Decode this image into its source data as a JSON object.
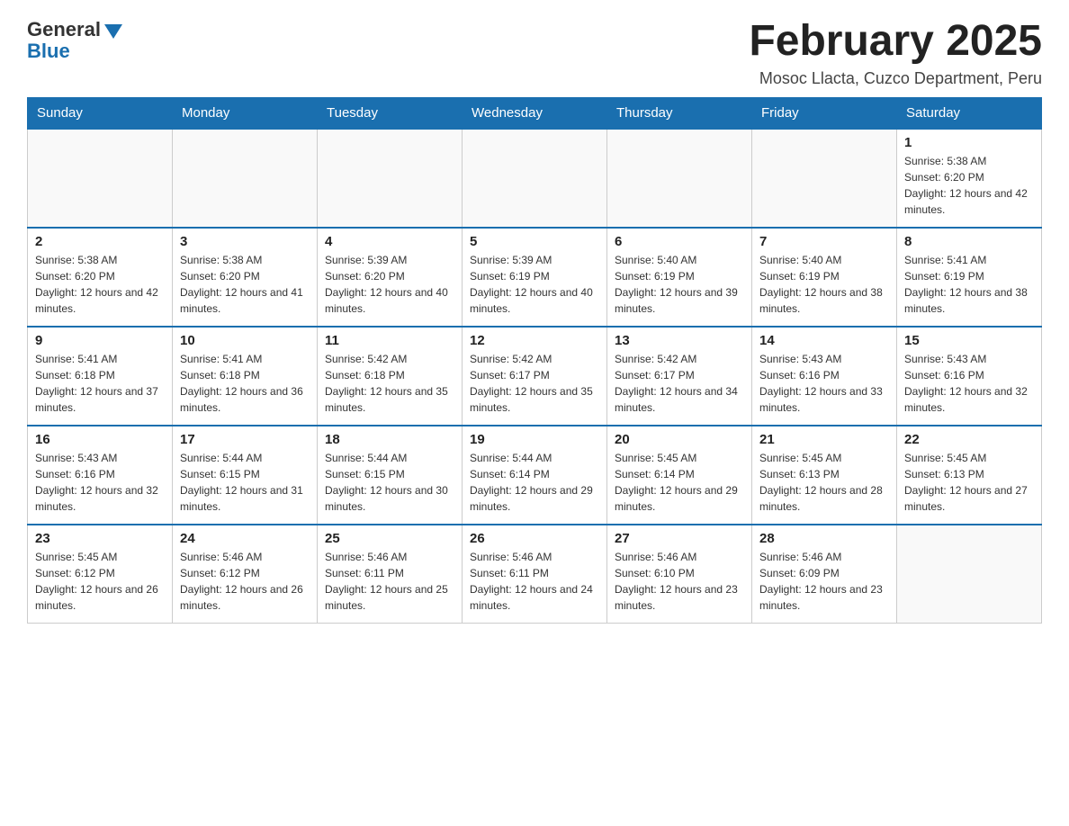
{
  "logo": {
    "general": "General",
    "blue": "Blue"
  },
  "header": {
    "title": "February 2025",
    "subtitle": "Mosoc Llacta, Cuzco Department, Peru"
  },
  "days_of_week": [
    "Sunday",
    "Monday",
    "Tuesday",
    "Wednesday",
    "Thursday",
    "Friday",
    "Saturday"
  ],
  "weeks": [
    {
      "days": [
        {
          "number": "",
          "info": ""
        },
        {
          "number": "",
          "info": ""
        },
        {
          "number": "",
          "info": ""
        },
        {
          "number": "",
          "info": ""
        },
        {
          "number": "",
          "info": ""
        },
        {
          "number": "",
          "info": ""
        },
        {
          "number": "1",
          "info": "Sunrise: 5:38 AM\nSunset: 6:20 PM\nDaylight: 12 hours and 42 minutes."
        }
      ]
    },
    {
      "days": [
        {
          "number": "2",
          "info": "Sunrise: 5:38 AM\nSunset: 6:20 PM\nDaylight: 12 hours and 42 minutes."
        },
        {
          "number": "3",
          "info": "Sunrise: 5:38 AM\nSunset: 6:20 PM\nDaylight: 12 hours and 41 minutes."
        },
        {
          "number": "4",
          "info": "Sunrise: 5:39 AM\nSunset: 6:20 PM\nDaylight: 12 hours and 40 minutes."
        },
        {
          "number": "5",
          "info": "Sunrise: 5:39 AM\nSunset: 6:19 PM\nDaylight: 12 hours and 40 minutes."
        },
        {
          "number": "6",
          "info": "Sunrise: 5:40 AM\nSunset: 6:19 PM\nDaylight: 12 hours and 39 minutes."
        },
        {
          "number": "7",
          "info": "Sunrise: 5:40 AM\nSunset: 6:19 PM\nDaylight: 12 hours and 38 minutes."
        },
        {
          "number": "8",
          "info": "Sunrise: 5:41 AM\nSunset: 6:19 PM\nDaylight: 12 hours and 38 minutes."
        }
      ]
    },
    {
      "days": [
        {
          "number": "9",
          "info": "Sunrise: 5:41 AM\nSunset: 6:18 PM\nDaylight: 12 hours and 37 minutes."
        },
        {
          "number": "10",
          "info": "Sunrise: 5:41 AM\nSunset: 6:18 PM\nDaylight: 12 hours and 36 minutes."
        },
        {
          "number": "11",
          "info": "Sunrise: 5:42 AM\nSunset: 6:18 PM\nDaylight: 12 hours and 35 minutes."
        },
        {
          "number": "12",
          "info": "Sunrise: 5:42 AM\nSunset: 6:17 PM\nDaylight: 12 hours and 35 minutes."
        },
        {
          "number": "13",
          "info": "Sunrise: 5:42 AM\nSunset: 6:17 PM\nDaylight: 12 hours and 34 minutes."
        },
        {
          "number": "14",
          "info": "Sunrise: 5:43 AM\nSunset: 6:16 PM\nDaylight: 12 hours and 33 minutes."
        },
        {
          "number": "15",
          "info": "Sunrise: 5:43 AM\nSunset: 6:16 PM\nDaylight: 12 hours and 32 minutes."
        }
      ]
    },
    {
      "days": [
        {
          "number": "16",
          "info": "Sunrise: 5:43 AM\nSunset: 6:16 PM\nDaylight: 12 hours and 32 minutes."
        },
        {
          "number": "17",
          "info": "Sunrise: 5:44 AM\nSunset: 6:15 PM\nDaylight: 12 hours and 31 minutes."
        },
        {
          "number": "18",
          "info": "Sunrise: 5:44 AM\nSunset: 6:15 PM\nDaylight: 12 hours and 30 minutes."
        },
        {
          "number": "19",
          "info": "Sunrise: 5:44 AM\nSunset: 6:14 PM\nDaylight: 12 hours and 29 minutes."
        },
        {
          "number": "20",
          "info": "Sunrise: 5:45 AM\nSunset: 6:14 PM\nDaylight: 12 hours and 29 minutes."
        },
        {
          "number": "21",
          "info": "Sunrise: 5:45 AM\nSunset: 6:13 PM\nDaylight: 12 hours and 28 minutes."
        },
        {
          "number": "22",
          "info": "Sunrise: 5:45 AM\nSunset: 6:13 PM\nDaylight: 12 hours and 27 minutes."
        }
      ]
    },
    {
      "days": [
        {
          "number": "23",
          "info": "Sunrise: 5:45 AM\nSunset: 6:12 PM\nDaylight: 12 hours and 26 minutes."
        },
        {
          "number": "24",
          "info": "Sunrise: 5:46 AM\nSunset: 6:12 PM\nDaylight: 12 hours and 26 minutes."
        },
        {
          "number": "25",
          "info": "Sunrise: 5:46 AM\nSunset: 6:11 PM\nDaylight: 12 hours and 25 minutes."
        },
        {
          "number": "26",
          "info": "Sunrise: 5:46 AM\nSunset: 6:11 PM\nDaylight: 12 hours and 24 minutes."
        },
        {
          "number": "27",
          "info": "Sunrise: 5:46 AM\nSunset: 6:10 PM\nDaylight: 12 hours and 23 minutes."
        },
        {
          "number": "28",
          "info": "Sunrise: 5:46 AM\nSunset: 6:09 PM\nDaylight: 12 hours and 23 minutes."
        },
        {
          "number": "",
          "info": ""
        }
      ]
    }
  ]
}
